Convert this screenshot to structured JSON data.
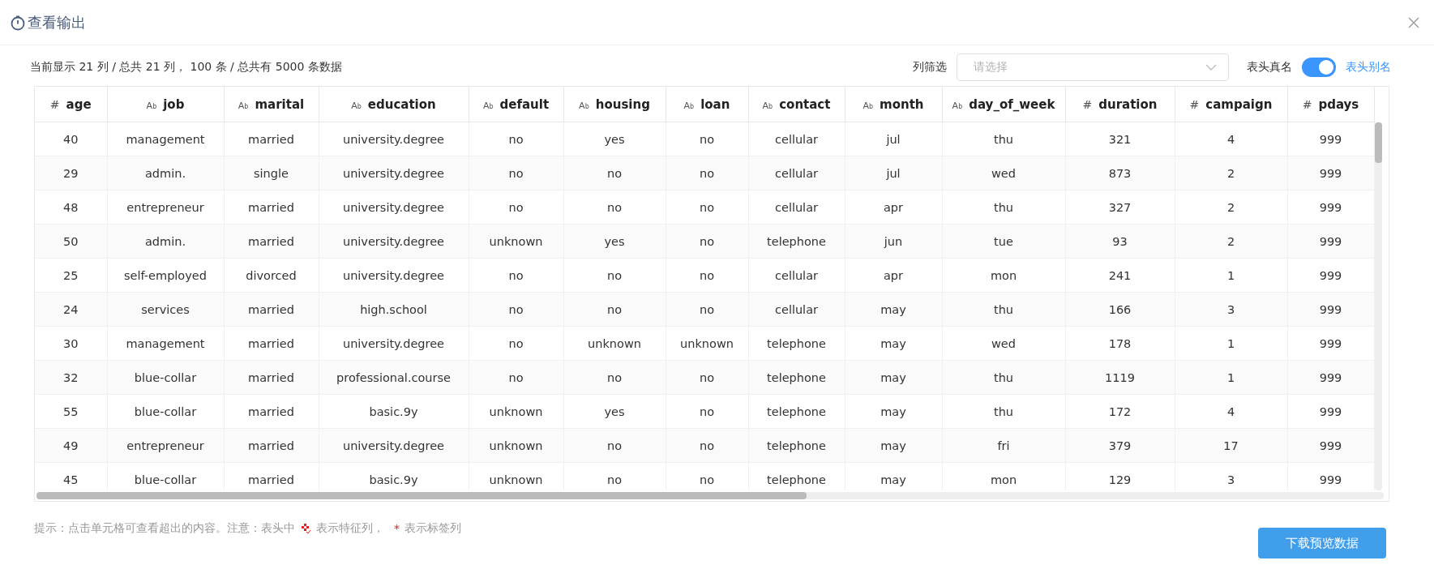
{
  "dialog": {
    "title": "查看输出"
  },
  "summary": "当前显示 21 列 / 总共 21 列， 100 条 / 总共有 5000 条数据",
  "column_filter": {
    "label": "列筛选",
    "placeholder": "请选择"
  },
  "header_mode": {
    "real_name_label": "表头真名",
    "on": true,
    "alias_label": "表头别名"
  },
  "table": {
    "columns": [
      {
        "name": "age",
        "kind": "number",
        "type_mark": "#"
      },
      {
        "name": "job",
        "kind": "text",
        "type_mark": "A$_{b}$"
      },
      {
        "name": "marital",
        "kind": "text",
        "type_mark": "A$_{b}$"
      },
      {
        "name": "education",
        "kind": "text",
        "type_mark": "A$_{b}$"
      },
      {
        "name": "default",
        "kind": "text",
        "type_mark": "A$_{b}$"
      },
      {
        "name": "housing",
        "kind": "text",
        "type_mark": "A$_{b}$"
      },
      {
        "name": "loan",
        "kind": "text",
        "type_mark": "A$_{b}$"
      },
      {
        "name": "contact",
        "kind": "text",
        "type_mark": "A$_{b}$"
      },
      {
        "name": "month",
        "kind": "text",
        "type_mark": "A$_{b}$"
      },
      {
        "name": "day_of_week",
        "kind": "text",
        "type_mark": "A$_{b}$"
      },
      {
        "name": "duration",
        "kind": "number",
        "type_mark": "#"
      },
      {
        "name": "campaign",
        "kind": "number",
        "type_mark": "#"
      },
      {
        "name": "pdays",
        "kind": "number",
        "type_mark": "#"
      }
    ],
    "rows": [
      [
        "40",
        "management",
        "married",
        "university.degree",
        "no",
        "yes",
        "no",
        "cellular",
        "jul",
        "thu",
        "321",
        "4",
        "999"
      ],
      [
        "29",
        "admin.",
        "single",
        "university.degree",
        "no",
        "no",
        "no",
        "cellular",
        "jul",
        "wed",
        "873",
        "2",
        "999"
      ],
      [
        "48",
        "entrepreneur",
        "married",
        "university.degree",
        "no",
        "no",
        "no",
        "cellular",
        "apr",
        "thu",
        "327",
        "2",
        "999"
      ],
      [
        "50",
        "admin.",
        "married",
        "university.degree",
        "unknown",
        "yes",
        "no",
        "telephone",
        "jun",
        "tue",
        "93",
        "2",
        "999"
      ],
      [
        "25",
        "self-employed",
        "divorced",
        "university.degree",
        "no",
        "no",
        "no",
        "cellular",
        "apr",
        "mon",
        "241",
        "1",
        "999"
      ],
      [
        "24",
        "services",
        "married",
        "high.school",
        "no",
        "no",
        "no",
        "cellular",
        "may",
        "thu",
        "166",
        "3",
        "999"
      ],
      [
        "30",
        "management",
        "married",
        "university.degree",
        "no",
        "unknown",
        "unknown",
        "telephone",
        "may",
        "wed",
        "178",
        "1",
        "999"
      ],
      [
        "32",
        "blue-collar",
        "married",
        "professional.course",
        "no",
        "no",
        "no",
        "telephone",
        "may",
        "thu",
        "1119",
        "1",
        "999"
      ],
      [
        "55",
        "blue-collar",
        "married",
        "basic.9y",
        "unknown",
        "yes",
        "no",
        "telephone",
        "may",
        "thu",
        "172",
        "4",
        "999"
      ],
      [
        "49",
        "entrepreneur",
        "married",
        "university.degree",
        "unknown",
        "no",
        "no",
        "telephone",
        "may",
        "fri",
        "379",
        "17",
        "999"
      ],
      [
        "45",
        "blue-collar",
        "married",
        "basic.9y",
        "unknown",
        "no",
        "no",
        "telephone",
        "may",
        "mon",
        "129",
        "3",
        "999"
      ]
    ]
  },
  "hint": {
    "lead": "提示：点击单元格可查看超出的内容。注意：表头中",
    "feature_text": "表示特征列，",
    "label_mark": "*",
    "label_text": "表示标签列"
  },
  "download_button": "下载预览数据"
}
